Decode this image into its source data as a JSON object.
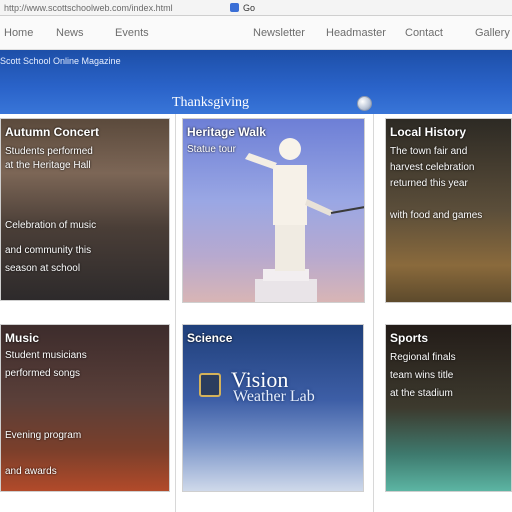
{
  "browser": {
    "url": "http://www.scottschoolweb.com/index.html",
    "tab_label": "Go"
  },
  "topnav": {
    "links": [
      "Home",
      "News",
      "Events",
      "Newsletter",
      "Headmaster",
      "Contact",
      "Gallery"
    ]
  },
  "banner": {
    "text": "Scott School Online Magazine",
    "title": "Thanksgiving"
  },
  "cards": [
    {
      "title": "Autumn Concert",
      "lines": [
        "Students performed",
        "at the Heritage Hall",
        "",
        "Celebration of music",
        "and community this",
        "season at school"
      ]
    },
    {
      "title": "Heritage Walk",
      "lines": [
        "Statue tour"
      ]
    },
    {
      "title": "Local History",
      "lines": [
        "The town fair and",
        "harvest celebration",
        "returned this year",
        "with food and games"
      ]
    },
    {
      "title": "Music",
      "lines": [
        "Student musicians",
        "performed songs",
        "",
        "Evening program",
        "and awards"
      ]
    },
    {
      "title": "Science",
      "lines": [
        "Vision",
        "Weather Lab"
      ]
    },
    {
      "title": "Sports",
      "lines": [
        "Regional finals",
        "team wins title",
        "at the stadium"
      ]
    }
  ]
}
